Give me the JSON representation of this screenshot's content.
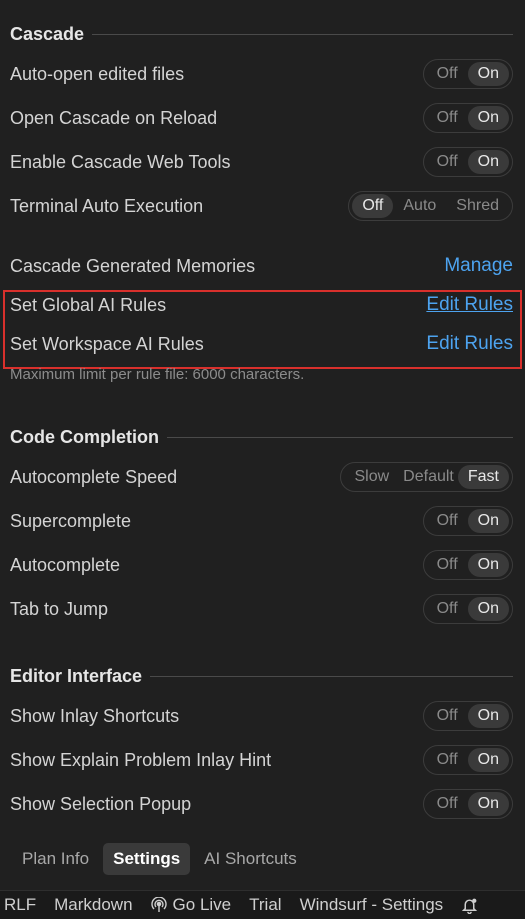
{
  "cascade": {
    "title": "Cascade",
    "auto_open": {
      "label": "Auto-open edited files",
      "off": "Off",
      "on": "On"
    },
    "open_on_reload": {
      "label": "Open Cascade on Reload",
      "off": "Off",
      "on": "On"
    },
    "web_tools": {
      "label": "Enable Cascade Web Tools",
      "off": "Off",
      "on": "On"
    },
    "terminal": {
      "label": "Terminal Auto Execution",
      "off": "Off",
      "auto": "Auto",
      "shred": "Shred"
    },
    "memories": {
      "label": "Cascade Generated Memories",
      "link": "Manage"
    },
    "global_rules": {
      "label": "Set Global AI Rules",
      "link": "Edit Rules"
    },
    "workspace_rules": {
      "label": "Set Workspace AI Rules",
      "link": "Edit Rules"
    },
    "note": "Maximum limit per rule file: 6000 characters."
  },
  "completion": {
    "title": "Code Completion",
    "speed": {
      "label": "Autocomplete Speed",
      "slow": "Slow",
      "default": "Default",
      "fast": "Fast"
    },
    "supercomplete": {
      "label": "Supercomplete",
      "off": "Off",
      "on": "On"
    },
    "autocomplete": {
      "label": "Autocomplete",
      "off": "Off",
      "on": "On"
    },
    "tab_jump": {
      "label": "Tab to Jump",
      "off": "Off",
      "on": "On"
    }
  },
  "editor": {
    "title": "Editor Interface",
    "inlay": {
      "label": "Show Inlay Shortcuts",
      "off": "Off",
      "on": "On"
    },
    "explain": {
      "label": "Show Explain Problem Inlay Hint",
      "off": "Off",
      "on": "On"
    },
    "popup": {
      "label": "Show Selection Popup",
      "off": "Off",
      "on": "On"
    }
  },
  "tabs": [
    "Plan Info",
    "Settings",
    "AI Shortcuts"
  ],
  "statusbar": {
    "eol": "RLF",
    "language": "Markdown",
    "golive": "Go Live",
    "trial": "Trial",
    "windsurf": "Windsurf - Settings"
  },
  "colors": {
    "accent_link": "#4da3ef",
    "highlight": "#d9302c"
  }
}
